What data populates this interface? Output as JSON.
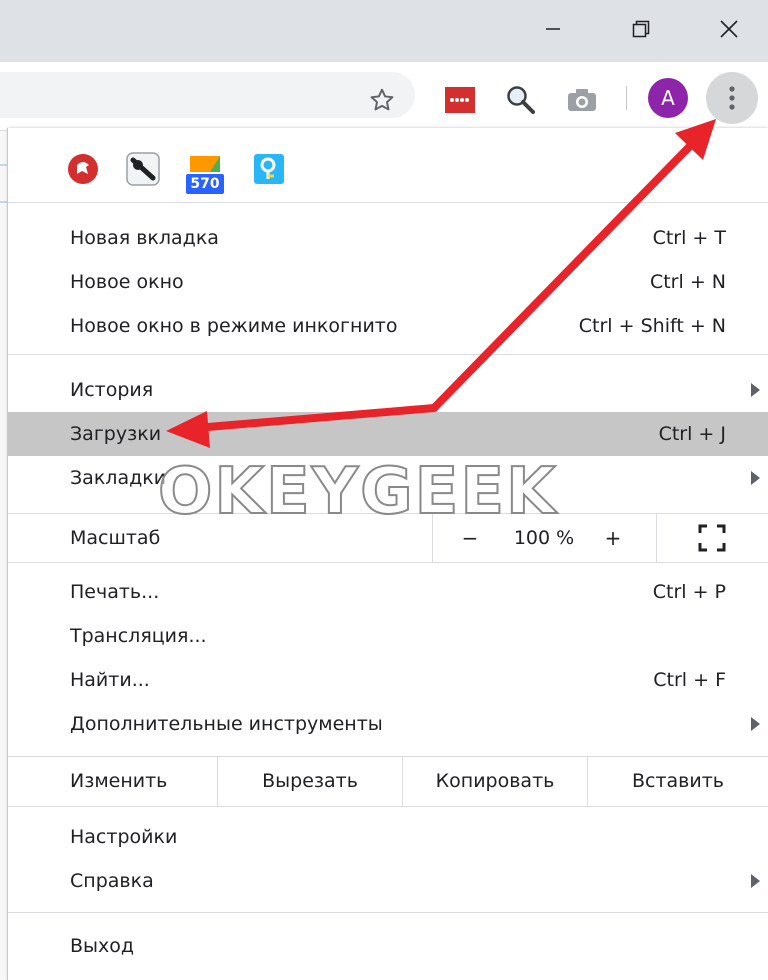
{
  "window": {
    "minimize_icon": "minimize-icon",
    "restore_icon": "restore-icon",
    "close_icon": "close-icon"
  },
  "toolbar": {
    "profile_initial": "A",
    "icons": [
      "star-icon",
      "extension-red-icon",
      "search-magnifier-icon",
      "camera-icon",
      "kebab-menu-icon"
    ]
  },
  "menu": {
    "extensions": [
      "extension-red-circle-icon",
      "extension-ninja-icon",
      "extension-badge-icon",
      "extension-pin-icon"
    ],
    "extension_badge_count": "570",
    "group1": [
      {
        "label": "Новая вкладка",
        "shortcut": "Ctrl + T"
      },
      {
        "label": "Новое окно",
        "shortcut": "Ctrl + N"
      },
      {
        "label": "Новое окно в режиме инкогнито",
        "shortcut": "Ctrl + Shift + N"
      }
    ],
    "group2": [
      {
        "label": "История",
        "shortcut": ""
      },
      {
        "label": "Загрузки",
        "shortcut": "Ctrl + J"
      },
      {
        "label": "Закладки",
        "shortcut": ""
      }
    ],
    "zoom": {
      "label": "Масштаб",
      "minus": "−",
      "value": "100 %",
      "plus": "+"
    },
    "group3": [
      {
        "label": "Печать...",
        "shortcut": "Ctrl + P"
      },
      {
        "label": "Трансляция...",
        "shortcut": ""
      },
      {
        "label": "Найти...",
        "shortcut": "Ctrl + F"
      },
      {
        "label": "Дополнительные инструменты",
        "shortcut": ""
      }
    ],
    "edit": {
      "label": "Изменить",
      "cut": "Вырезать",
      "copy": "Копировать",
      "paste": "Вставить"
    },
    "group4": [
      {
        "label": "Настройки",
        "shortcut": ""
      },
      {
        "label": "Справка",
        "shortcut": ""
      }
    ],
    "exit": {
      "label": "Выход"
    }
  },
  "watermark": "OKEYGEEK",
  "colors": {
    "annotation_arrow": "#e8242a",
    "highlight": "#c6c6c6",
    "avatar": "#8e24aa"
  }
}
